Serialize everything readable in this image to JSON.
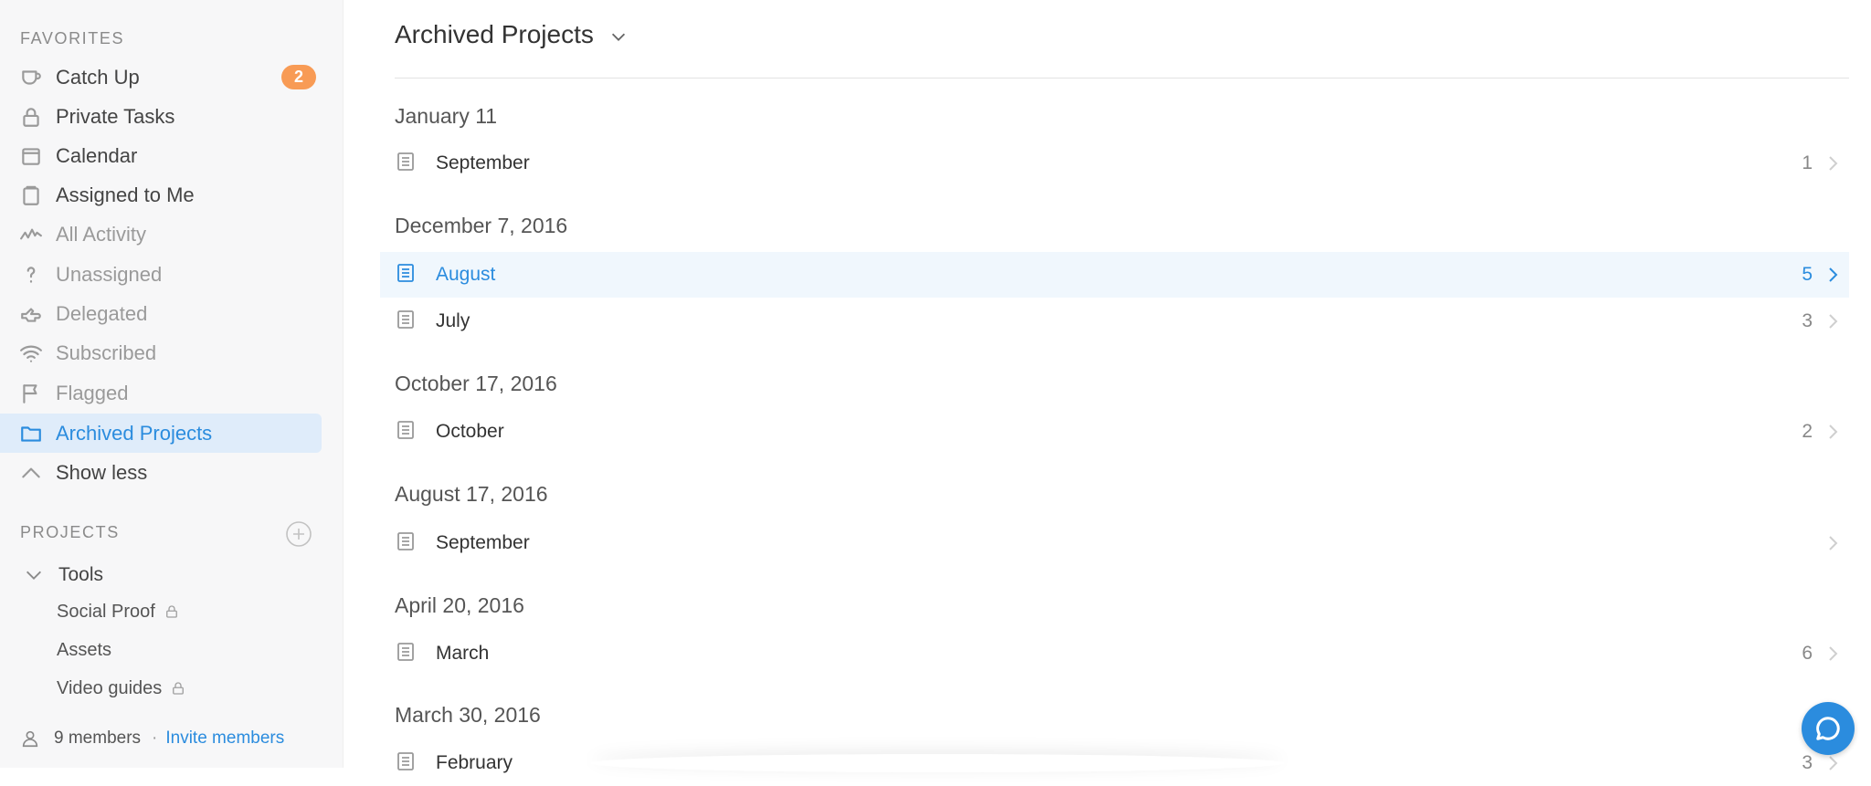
{
  "sidebar": {
    "favorites_label": "FAVORITES",
    "favorites": [
      {
        "label": "Catch Up",
        "icon": "cup-icon",
        "badge": "2"
      },
      {
        "label": "Private Tasks",
        "icon": "lock-icon"
      },
      {
        "label": "Calendar",
        "icon": "calendar-icon"
      },
      {
        "label": "Assigned to Me",
        "icon": "clipboard-icon"
      },
      {
        "label": "All Activity",
        "icon": "activity-icon"
      },
      {
        "label": "Unassigned",
        "icon": "question-icon"
      },
      {
        "label": "Delegated",
        "icon": "delegate-hand-icon"
      },
      {
        "label": "Subscribed",
        "icon": "wifi-icon"
      },
      {
        "label": "Flagged",
        "icon": "flag-icon"
      },
      {
        "label": "Archived Projects",
        "icon": "folder-icon"
      },
      {
        "label": "Show less",
        "icon": "chevron-up-icon"
      }
    ],
    "projects_label": "PROJECTS",
    "project_group": "Tools",
    "projects": [
      {
        "label": "Social Proof",
        "private": true
      },
      {
        "label": "Assets",
        "private": false
      },
      {
        "label": "Video guides",
        "private": true
      }
    ],
    "members": "9 members",
    "invite": "Invite members"
  },
  "main": {
    "title": "Archived Projects",
    "groups": [
      {
        "date": "January 11",
        "items": [
          {
            "name": "September",
            "count": "1"
          }
        ]
      },
      {
        "date": "December 7, 2016",
        "items": [
          {
            "name": "August",
            "count": "5"
          },
          {
            "name": "July",
            "count": "3"
          }
        ]
      },
      {
        "date": "October 17, 2016",
        "items": [
          {
            "name": "October",
            "count": "2"
          }
        ]
      },
      {
        "date": "August 17, 2016",
        "items": [
          {
            "name": "September",
            "count": ""
          }
        ]
      },
      {
        "date": "April 20, 2016",
        "items": [
          {
            "name": "March",
            "count": "6"
          }
        ]
      },
      {
        "date": "March 30, 2016",
        "items": [
          {
            "name": "February",
            "count": "3"
          }
        ]
      }
    ]
  },
  "colors": {
    "accent": "#2b8cde",
    "badge": "#f89b55",
    "active_bg": "#dfecfa"
  }
}
